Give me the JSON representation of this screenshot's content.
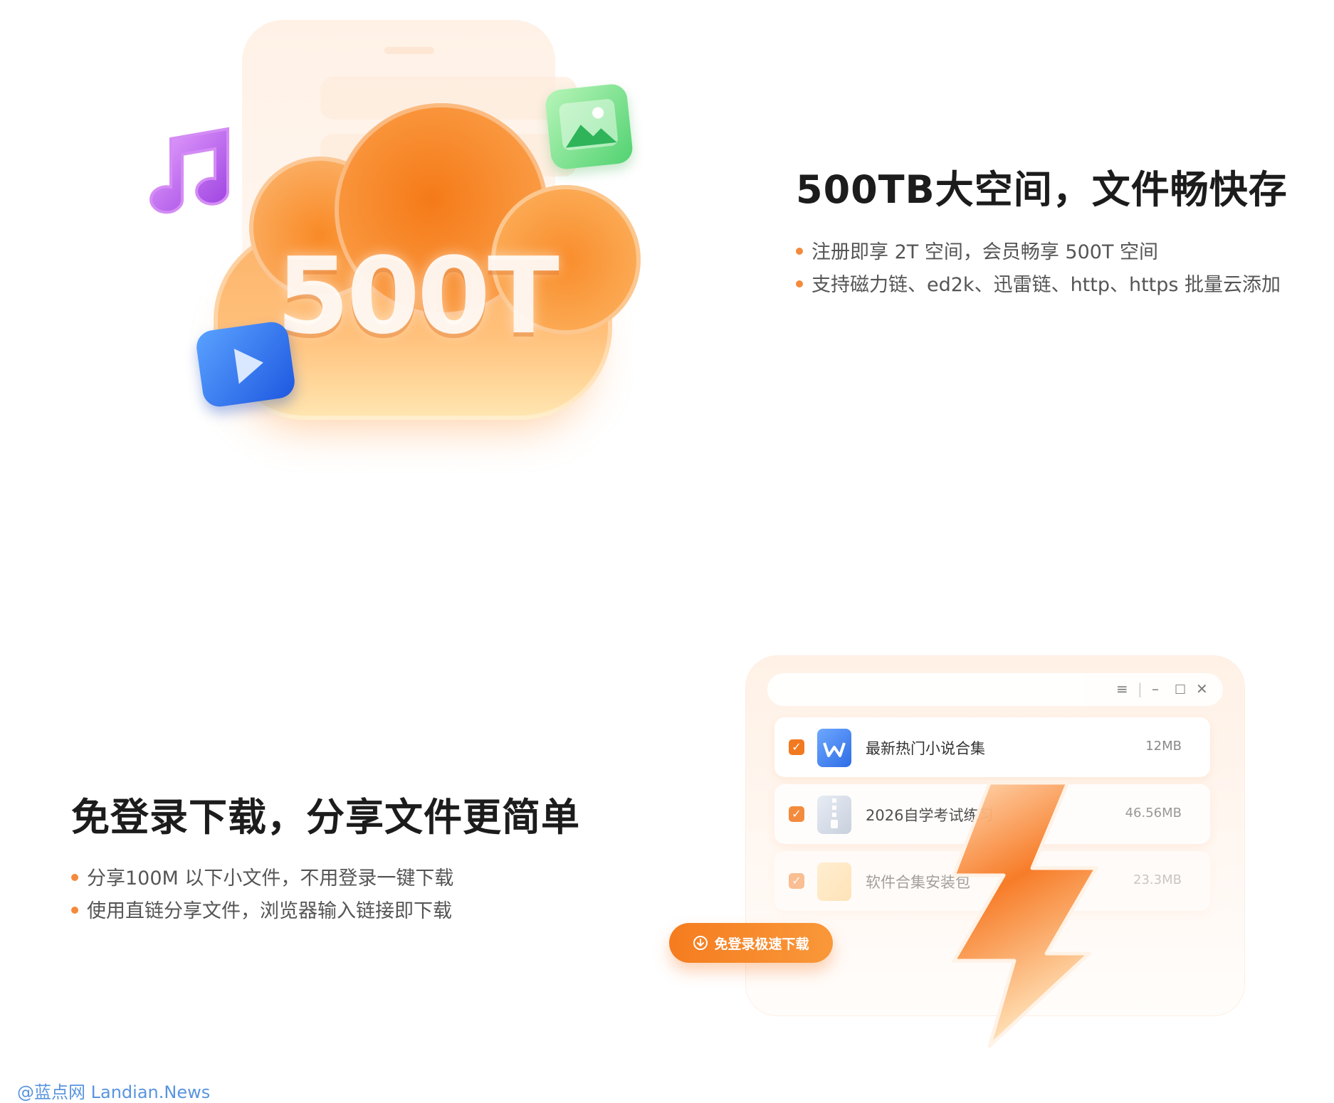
{
  "section1": {
    "hero_text": "500T",
    "title": "500TB大空间，文件畅快存",
    "bullets": [
      "注册即享 2T 空间，会员畅享 500T 空间",
      "支持磁力链、ed2k、迅雷链、http、https 批量云添加"
    ],
    "icons": [
      "music-note-icon",
      "picture-icon",
      "play-icon",
      "cloud-icon"
    ]
  },
  "section2": {
    "title": "免登录下载，分享文件更简单",
    "bullets": [
      "分享100M 以下小文件，不用登录一键下载",
      "使用直链分享文件，浏览器输入链接即下载"
    ],
    "window": {
      "controls": [
        "menu-icon",
        "minimize-icon",
        "maximize-icon",
        "close-icon"
      ],
      "files": [
        {
          "name": "最新热门小说合集",
          "size": "12MB",
          "icon": "word-doc-icon",
          "checked": true
        },
        {
          "name": "2026自学考试练习",
          "size": "46.56MB",
          "icon": "zip-archive-icon",
          "checked": true
        },
        {
          "name": "软件合集安装包",
          "size": "23.3MB",
          "icon": "folder-icon",
          "checked": true
        }
      ]
    },
    "download_button": "免登录极速下载"
  },
  "watermark": "@蓝点网 Landian.News",
  "colors": {
    "accent": "#f57c1f",
    "bullet_dot": "#f58a3c",
    "title_text": "#1c1c1c",
    "body_text": "#555555"
  }
}
